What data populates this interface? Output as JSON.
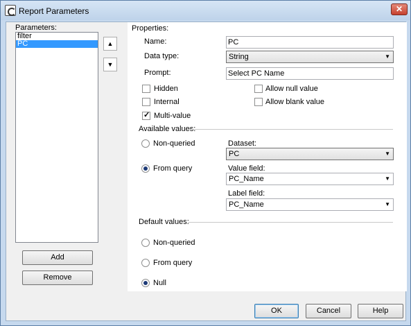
{
  "window": {
    "title": "Report Parameters"
  },
  "left": {
    "parameters_label": "Parameters:",
    "items": [
      {
        "label": "filter",
        "selected": false
      },
      {
        "label": "PC",
        "selected": true
      }
    ],
    "add_label": "Add",
    "remove_label": "Remove"
  },
  "properties": {
    "header": "Properties:",
    "name_label": "Name:",
    "name_value": "PC",
    "data_type_label": "Data type:",
    "data_type_value": "String",
    "prompt_label": "Prompt:",
    "prompt_value": "Select PC Name",
    "hidden_label": "Hidden",
    "hidden_checked": false,
    "internal_label": "Internal",
    "internal_checked": false,
    "multivalue_label": "Multi-value",
    "multivalue_checked": true,
    "allow_null_label": "Allow null value",
    "allow_null_checked": false,
    "allow_blank_label": "Allow blank value",
    "allow_blank_checked": false
  },
  "available": {
    "header": "Available values:",
    "nonqueried_label": "Non-queried",
    "fromquery_label": "From query",
    "selected": "fromquery",
    "dataset_label": "Dataset:",
    "dataset_value": "PC",
    "value_field_label": "Value field:",
    "value_field_value": "PC_Name",
    "label_field_label": "Label field:",
    "label_field_value": "PC_Name"
  },
  "default": {
    "header": "Default values:",
    "nonqueried_label": "Non-queried",
    "fromquery_label": "From query",
    "null_label": "Null",
    "selected": "null"
  },
  "buttons": {
    "ok": "OK",
    "cancel": "Cancel",
    "help": "Help"
  }
}
